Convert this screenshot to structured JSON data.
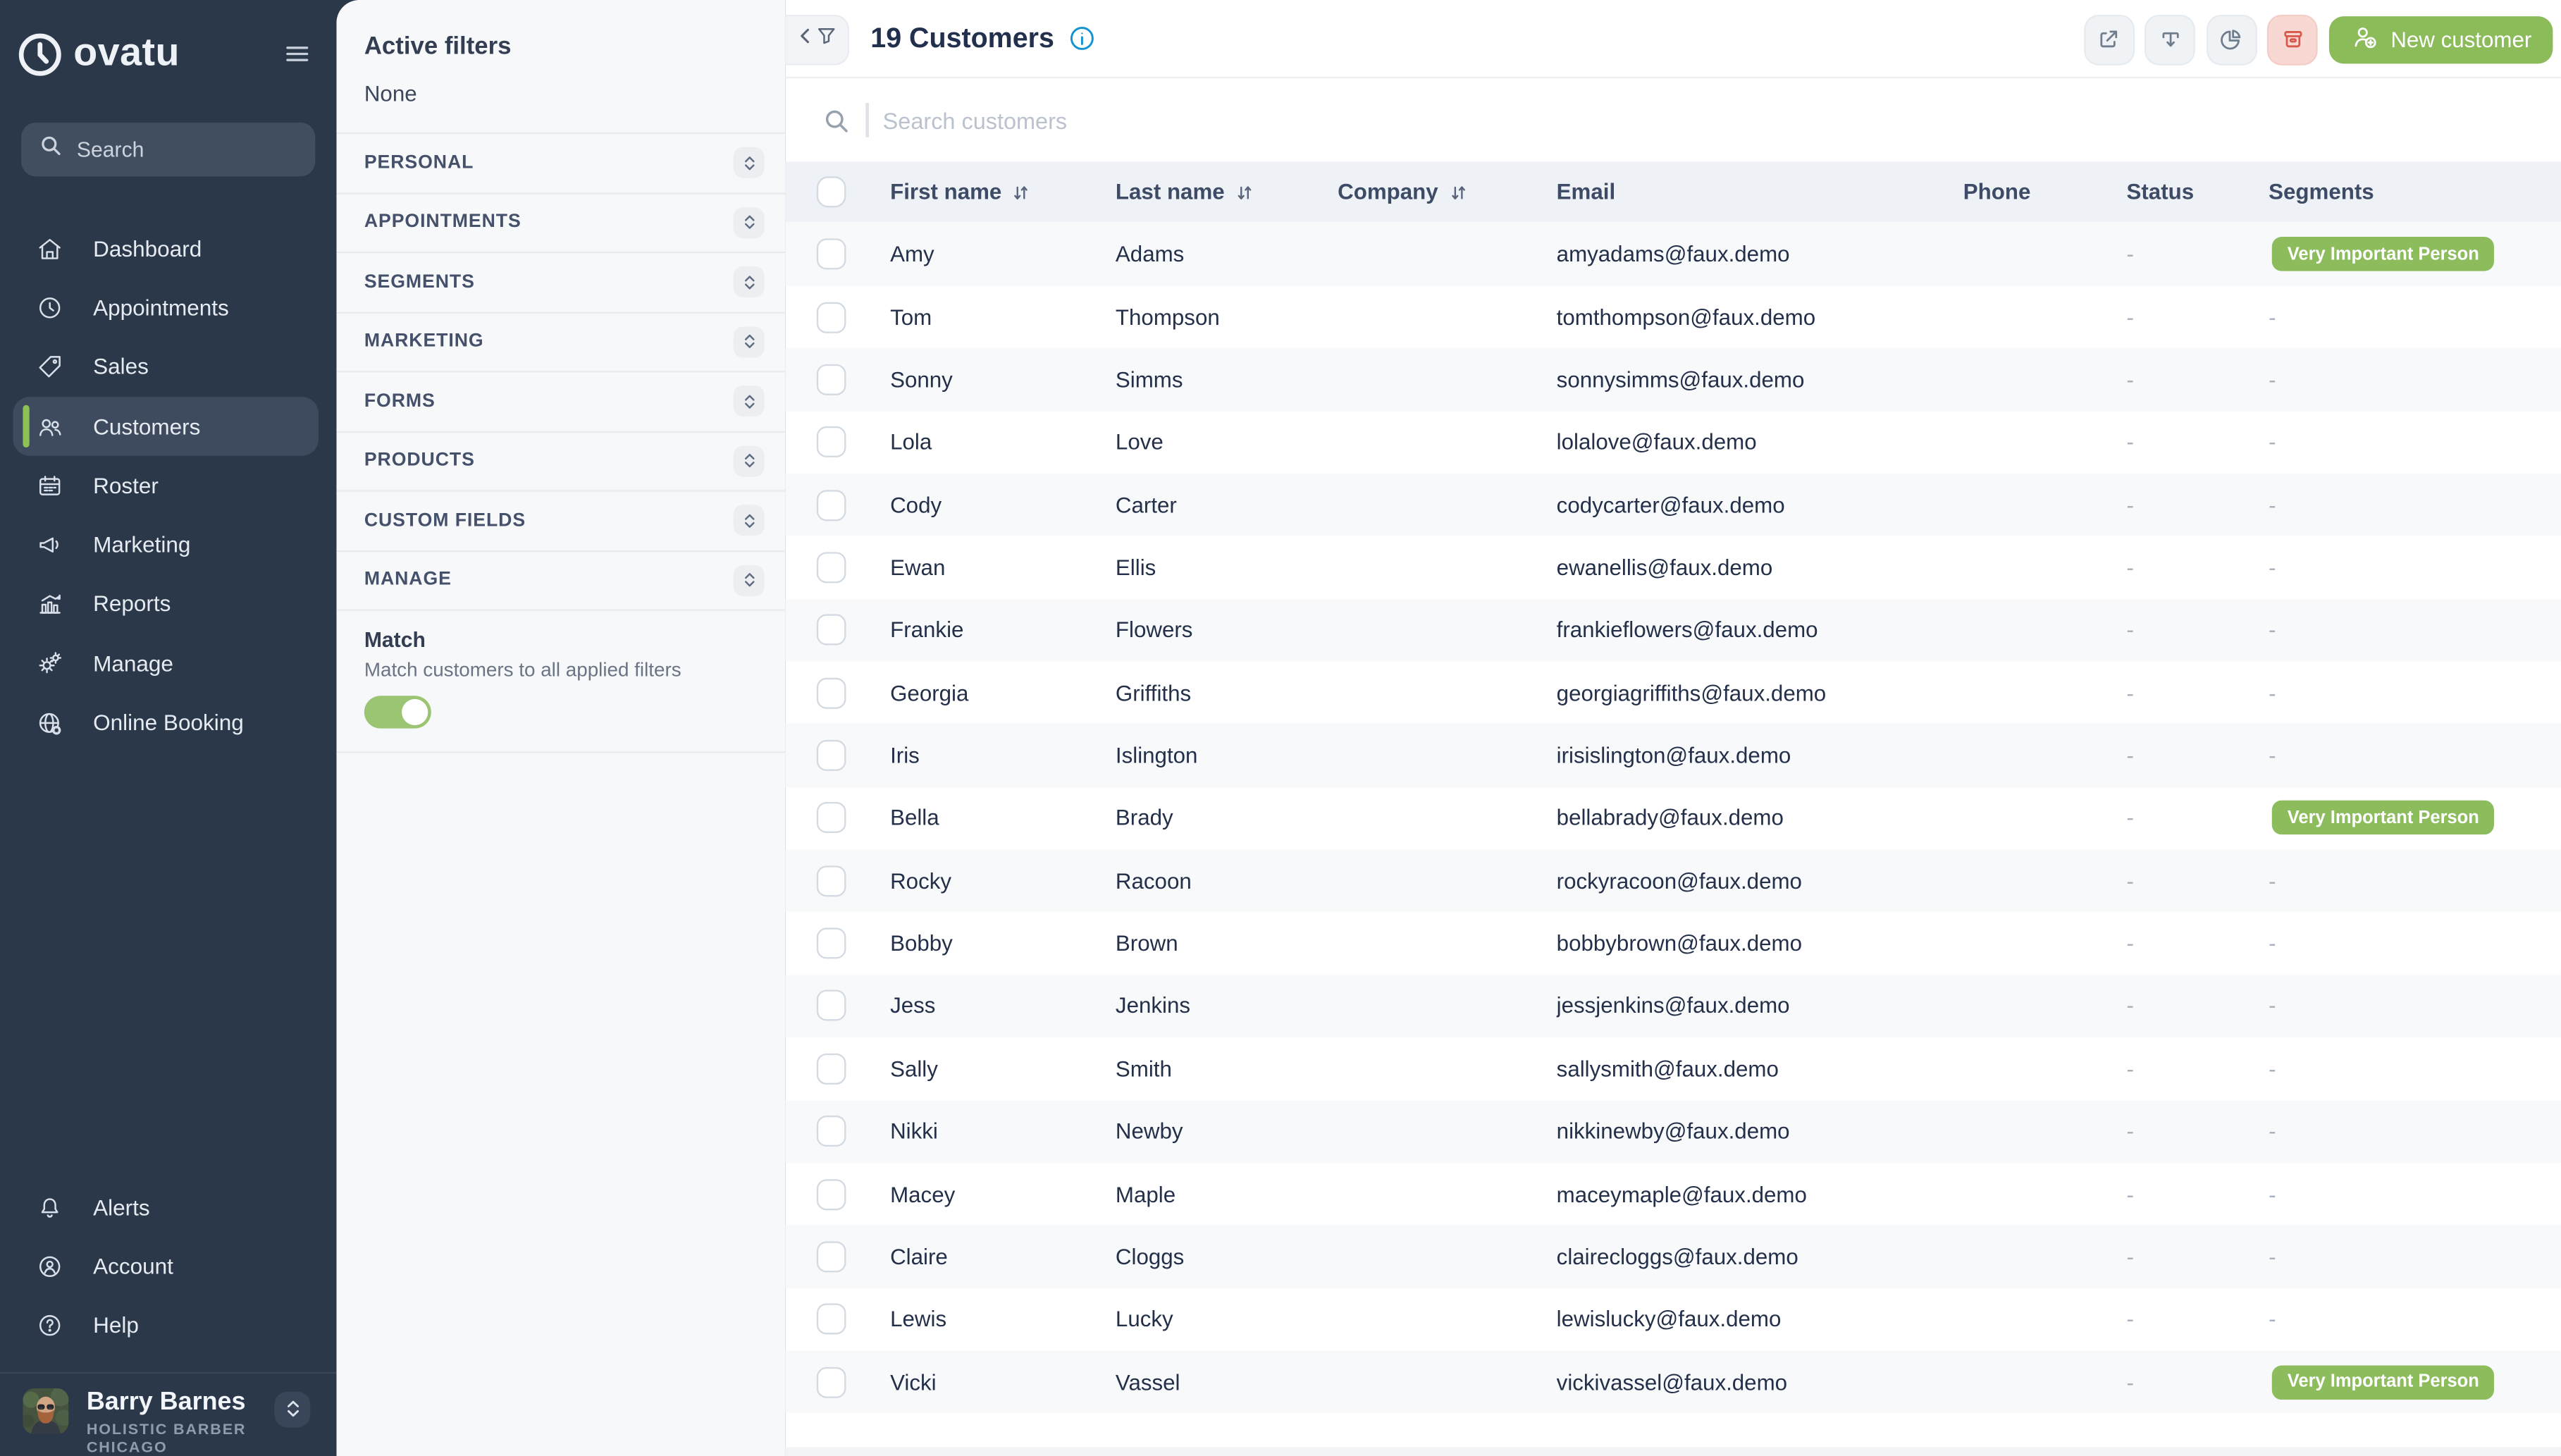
{
  "sidebar": {
    "brand": "ovatu",
    "search_placeholder": "Search",
    "nav": [
      {
        "label": "Dashboard",
        "icon": "home",
        "active": false
      },
      {
        "label": "Appointments",
        "icon": "clock",
        "active": false
      },
      {
        "label": "Sales",
        "icon": "tag",
        "active": false
      },
      {
        "label": "Customers",
        "icon": "users",
        "active": true
      },
      {
        "label": "Roster",
        "icon": "calendar",
        "active": false
      },
      {
        "label": "Marketing",
        "icon": "megaphone",
        "active": false
      },
      {
        "label": "Reports",
        "icon": "chart",
        "active": false
      },
      {
        "label": "Manage",
        "icon": "gears",
        "active": false
      },
      {
        "label": "Online Booking",
        "icon": "globe",
        "active": false
      }
    ],
    "secondary_nav": [
      {
        "label": "Alerts",
        "icon": "bell"
      },
      {
        "label": "Account",
        "icon": "person-circle"
      },
      {
        "label": "Help",
        "icon": "question-circle"
      }
    ],
    "profile": {
      "name": "Barry Barnes",
      "business_line1": "HOLISTIC BARBER",
      "business_line2": "CHICAGO"
    }
  },
  "filter_panel": {
    "title": "Active filters",
    "empty_value": "None",
    "sections": [
      "PERSONAL",
      "APPOINTMENTS",
      "SEGMENTS",
      "MARKETING",
      "FORMS",
      "PRODUCTS",
      "CUSTOM FIELDS",
      "MANAGE"
    ],
    "match_title": "Match",
    "match_description": "Match customers to all applied filters",
    "match_enabled": true
  },
  "header": {
    "title": "19 Customers",
    "search_placeholder": "Search customers",
    "new_customer_label": "New customer"
  },
  "table": {
    "columns": [
      {
        "label": "First name",
        "sortable": true
      },
      {
        "label": "Last name",
        "sortable": true
      },
      {
        "label": "Company",
        "sortable": true
      },
      {
        "label": "Email",
        "sortable": false
      },
      {
        "label": "Phone",
        "sortable": false
      },
      {
        "label": "Status",
        "sortable": false
      },
      {
        "label": "Segments",
        "sortable": false
      }
    ],
    "empty_placeholder": "-",
    "vip_badge": "Very Important Person",
    "rows": [
      {
        "first": "Amy",
        "last": "Adams",
        "company": "",
        "email": "amyadams@faux.demo",
        "phone": "",
        "status": "-",
        "vip": true
      },
      {
        "first": "Tom",
        "last": "Thompson",
        "company": "",
        "email": "tomthompson@faux.demo",
        "phone": "",
        "status": "-",
        "vip": false
      },
      {
        "first": "Sonny",
        "last": "Simms",
        "company": "",
        "email": "sonnysimms@faux.demo",
        "phone": "",
        "status": "-",
        "vip": false
      },
      {
        "first": "Lola",
        "last": "Love",
        "company": "",
        "email": "lolalove@faux.demo",
        "phone": "",
        "status": "-",
        "vip": false
      },
      {
        "first": "Cody",
        "last": "Carter",
        "company": "",
        "email": "codycarter@faux.demo",
        "phone": "",
        "status": "-",
        "vip": false
      },
      {
        "first": "Ewan",
        "last": "Ellis",
        "company": "",
        "email": "ewanellis@faux.demo",
        "phone": "",
        "status": "-",
        "vip": false
      },
      {
        "first": "Frankie",
        "last": "Flowers",
        "company": "",
        "email": "frankieflowers@faux.demo",
        "phone": "",
        "status": "-",
        "vip": false
      },
      {
        "first": "Georgia",
        "last": "Griffiths",
        "company": "",
        "email": "georgiagriffiths@faux.demo",
        "phone": "",
        "status": "-",
        "vip": false
      },
      {
        "first": "Iris",
        "last": "Islington",
        "company": "",
        "email": "irisislington@faux.demo",
        "phone": "",
        "status": "-",
        "vip": false
      },
      {
        "first": "Bella",
        "last": "Brady",
        "company": "",
        "email": "bellabrady@faux.demo",
        "phone": "",
        "status": "-",
        "vip": true
      },
      {
        "first": "Rocky",
        "last": "Racoon",
        "company": "",
        "email": "rockyracoon@faux.demo",
        "phone": "",
        "status": "-",
        "vip": false
      },
      {
        "first": "Bobby",
        "last": "Brown",
        "company": "",
        "email": "bobbybrown@faux.demo",
        "phone": "",
        "status": "-",
        "vip": false
      },
      {
        "first": "Jess",
        "last": "Jenkins",
        "company": "",
        "email": "jessjenkins@faux.demo",
        "phone": "",
        "status": "-",
        "vip": false
      },
      {
        "first": "Sally",
        "last": "Smith",
        "company": "",
        "email": "sallysmith@faux.demo",
        "phone": "",
        "status": "-",
        "vip": false
      },
      {
        "first": "Nikki",
        "last": "Newby",
        "company": "",
        "email": "nikkinewby@faux.demo",
        "phone": "",
        "status": "-",
        "vip": false
      },
      {
        "first": "Macey",
        "last": "Maple",
        "company": "",
        "email": "maceymaple@faux.demo",
        "phone": "",
        "status": "-",
        "vip": false
      },
      {
        "first": "Claire",
        "last": "Cloggs",
        "company": "",
        "email": "clairecloggs@faux.demo",
        "phone": "",
        "status": "-",
        "vip": false
      },
      {
        "first": "Lewis",
        "last": "Lucky",
        "company": "",
        "email": "lewislucky@faux.demo",
        "phone": "",
        "status": "-",
        "vip": false
      },
      {
        "first": "Vicki",
        "last": "Vassel",
        "company": "",
        "email": "vickivassel@faux.demo",
        "phone": "",
        "status": "-",
        "vip": true
      }
    ]
  },
  "colors": {
    "sidebar_bg": "#2b3849",
    "accent_green": "#8bbc59",
    "toggle_green": "#9bc573",
    "badge_green": "#8cbc5c",
    "danger_red": "#d8584a",
    "danger_bg": "#f8d8d3",
    "info_blue": "#1593cf",
    "row_stripe": "#f7f9fb",
    "table_header_bg": "#eef1f5"
  }
}
